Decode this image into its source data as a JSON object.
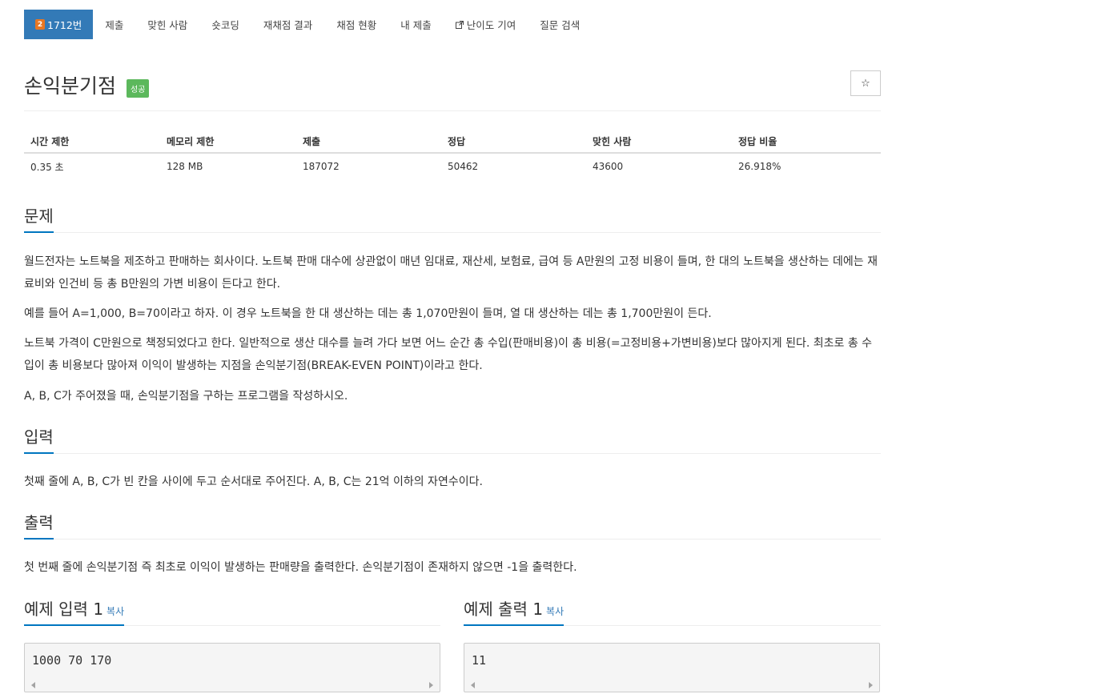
{
  "nav": {
    "problem": {
      "tier": "2",
      "label": "1712번"
    },
    "items": [
      "제출",
      "맞힌 사람",
      "숏코딩",
      "재채점 결과",
      "채점 현황",
      "내 제출"
    ],
    "difficulty": "난이도 기여",
    "search": "질문 검색"
  },
  "title": "손익분기점",
  "status_badge": "성공",
  "star_icon": "☆",
  "stats": {
    "headers": [
      "시간 제한",
      "메모리 제한",
      "제출",
      "정답",
      "맞힌 사람",
      "정답 비율"
    ],
    "values": [
      "0.35 초",
      "128 MB",
      "187072",
      "50462",
      "43600",
      "26.918%"
    ]
  },
  "problem": {
    "heading": "문제",
    "p1": "월드전자는 노트북을 제조하고 판매하는 회사이다. 노트북 판매 대수에 상관없이 매년 임대료, 재산세, 보험료, 급여 등 A만원의 고정 비용이 들며, 한 대의 노트북을 생산하는 데에는 재료비와 인건비 등 총 B만원의 가변 비용이 든다고 한다.",
    "p2": "예를 들어 A=1,000, B=70이라고 하자. 이 경우 노트북을 한 대 생산하는 데는 총 1,070만원이 들며, 열 대 생산하는 데는 총 1,700만원이 든다.",
    "p3": "노트북 가격이 C만원으로 책정되었다고 한다. 일반적으로 생산 대수를 늘려 가다 보면 어느 순간 총 수입(판매비용)이 총 비용(=고정비용+가변비용)보다 많아지게 된다. 최초로 총 수입이 총 비용보다 많아져 이익이 발생하는 지점을 손익분기점(BREAK-EVEN POINT)이라고 한다.",
    "p4": "A, B, C가 주어졌을 때, 손익분기점을 구하는 프로그램을 작성하시오."
  },
  "input": {
    "heading": "입력",
    "text": "첫째 줄에 A, B, C가 빈 칸을 사이에 두고 순서대로 주어진다. A, B, C는 21억 이하의 자연수이다."
  },
  "output": {
    "heading": "출력",
    "text": "첫 번째 줄에 손익분기점 즉 최초로 이익이 발생하는 판매량을 출력한다. 손익분기점이 존재하지 않으면 -1을 출력한다."
  },
  "sample_input": {
    "heading": "예제 입력 1",
    "copy": "복사",
    "value": "1000 70 170"
  },
  "sample_output": {
    "heading": "예제 출력 1",
    "copy": "복사",
    "value": "11"
  }
}
